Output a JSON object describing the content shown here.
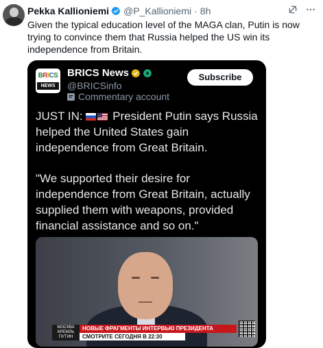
{
  "tweet": {
    "author_name": "Pekka Kallioniemi",
    "handle": "@P_Kallioniemi",
    "separator": "·",
    "time": "8h",
    "text": "Given the typical education level of the MAGA clan, Putin is now trying to convince them that Russia helped the US win its independence from Britain."
  },
  "quote": {
    "logo_text": "BRICS",
    "logo_sub": "NEWS",
    "name": "BRICS News",
    "handle": "@BRICSinfo",
    "label": "Commentary account",
    "subscribe_label": "Subscribe",
    "body_line1_prefix": "JUST IN:",
    "body_line1_rest": "President Putin says Russia helped the United States gain independence from Great Britain.",
    "body_quote": "\"We supported their desire for independence from Great Britain, actually supplied them with weapons, provided financial assistance and so on.\"",
    "video": {
      "channel_logo_lines": [
        "МОСКВА",
        "КРЕМЛЬ",
        "ПУТИН"
      ],
      "ticker_headline": "НОВЫЕ ФРАГМЕНТЫ ИНТЕРВЬЮ ПРЕЗИДЕНТА",
      "ticker_subline": "СМОТРИТЕ СЕГОДНЯ В 22:30"
    }
  },
  "icons": {
    "verified": "verified-badge-icon",
    "grok": "grok-icon",
    "more": "more-icon",
    "commentary": "commentary-badge-icon",
    "gold_verified": "gold-verified-badge-icon",
    "play_badge": "green-play-badge-icon"
  },
  "colors": {
    "verified_blue": "#1d9bf0",
    "gold": "#e2b719",
    "text": "#0f1419",
    "secondary": "#536471",
    "quote_bg": "#000000",
    "ticker_red": "#c6171d"
  }
}
